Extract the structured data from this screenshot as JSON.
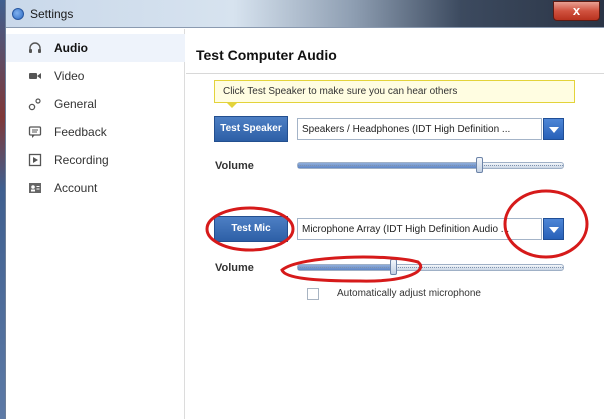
{
  "window": {
    "title": "Settings",
    "close_label": "x"
  },
  "sidebar": {
    "items": [
      {
        "label": "Audio",
        "icon": "headphones-icon",
        "active": true
      },
      {
        "label": "Video",
        "icon": "video-camera-icon",
        "active": false
      },
      {
        "label": "General",
        "icon": "gear-icon",
        "active": false
      },
      {
        "label": "Feedback",
        "icon": "speech-bubble-icon",
        "active": false
      },
      {
        "label": "Recording",
        "icon": "play-box-icon",
        "active": false
      },
      {
        "label": "Account",
        "icon": "person-card-icon",
        "active": false
      }
    ]
  },
  "audio": {
    "heading": "Test Computer Audio",
    "tooltip": "Click Test Speaker to make sure you can hear others",
    "speaker": {
      "button_label": "Test Speaker",
      "device": "Speakers / Headphones (IDT High Definition ...",
      "volume_label": "Volume",
      "volume_level": 0.68
    },
    "mic": {
      "button_label": "Test Mic",
      "device": "Microphone Array (IDT High Definition Audio ...",
      "volume_label": "Volume",
      "volume_level": 0.36
    },
    "auto_adjust_label": "Automatically adjust microphone",
    "auto_adjust_checked": false
  },
  "colors": {
    "accent_blue": "#2d5fa6",
    "annotation_red": "#d61a1a",
    "tooltip_bg": "#fffde1"
  }
}
